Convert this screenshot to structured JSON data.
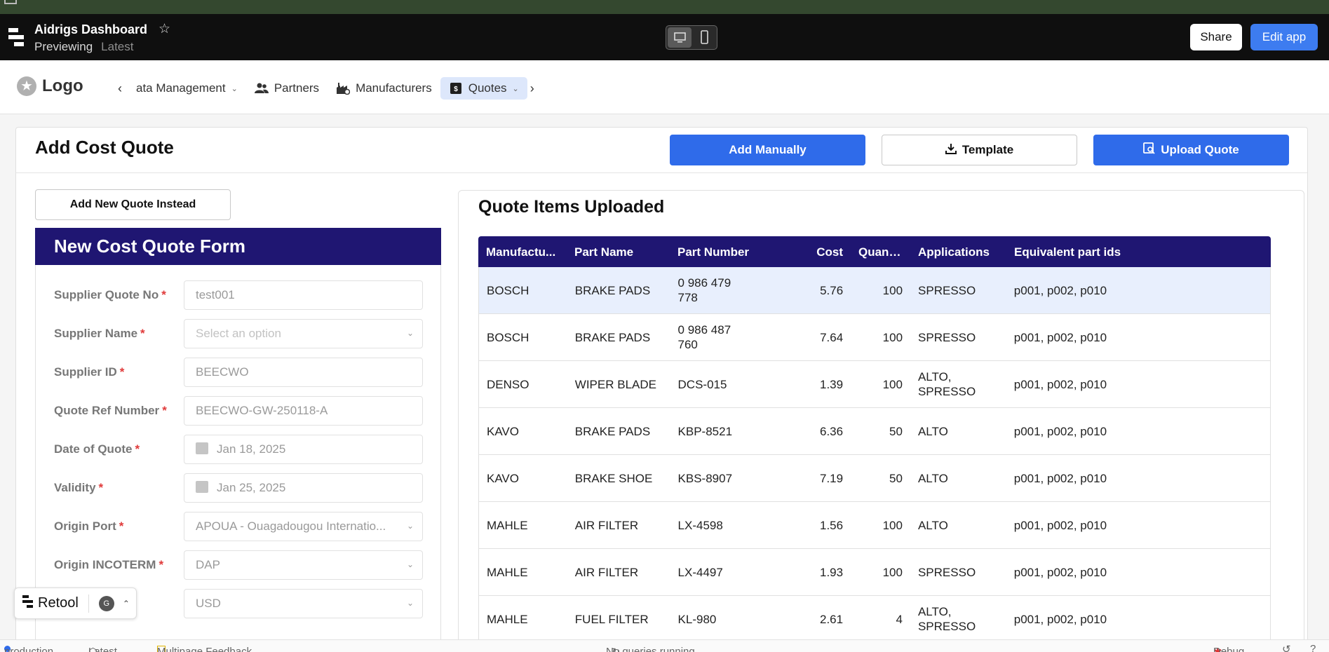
{
  "appbar": {
    "title": "Aidrigs Dashboard",
    "mode": "Previewing",
    "version": "Latest",
    "share_label": "Share",
    "edit_label": "Edit app"
  },
  "nav": {
    "logo_text": "Logo",
    "items": [
      {
        "label": "ata Management",
        "icon": "chevron-down-icon"
      },
      {
        "label": "Partners",
        "icon": "users-icon"
      },
      {
        "label": "Manufacturers",
        "icon": "factory-icon"
      },
      {
        "label": "Quotes",
        "icon": "receipt-icon",
        "active": true
      }
    ]
  },
  "page": {
    "title": "Add Cost Quote",
    "add_manually_label": "Add Manually",
    "template_label": "Template",
    "upload_quote_label": "Upload Quote",
    "add_new_quote_label": "Add New Quote Instead"
  },
  "form": {
    "header": "New Cost Quote Form",
    "fields": [
      {
        "label": "Supplier Quote No",
        "value": "test001",
        "type": "text"
      },
      {
        "label": "Supplier Name",
        "value": "Select an option",
        "type": "select-placeholder"
      },
      {
        "label": "Supplier ID",
        "value": "BEECWO",
        "type": "text"
      },
      {
        "label": "Quote Ref Number",
        "value": "BEECWO-GW-250118-A",
        "type": "text"
      },
      {
        "label": "Date of Quote",
        "value": "Jan 18, 2025",
        "type": "date"
      },
      {
        "label": "Validity",
        "value": "Jan 25, 2025",
        "type": "date"
      },
      {
        "label": "Origin Port",
        "value": "APOUA - Ouagadougou Internatio...",
        "type": "select"
      },
      {
        "label": "Origin INCOTERM",
        "value": "DAP",
        "type": "select"
      },
      {
        "label": "",
        "value": "USD",
        "type": "select"
      }
    ],
    "required_mark": "*"
  },
  "quote_items": {
    "title": "Quote Items Uploaded",
    "columns": [
      "Manufactu...",
      "Part Name",
      "Part Number",
      "Cost",
      "Quant...",
      "Applications",
      "Equivalent part ids"
    ],
    "rows": [
      {
        "manufacturer": "BOSCH",
        "part_name": "BRAKE PADS",
        "part_number": "0 986 479 778",
        "cost": "5.76",
        "quantity": "100",
        "applications": "SPRESSO",
        "equivalent": "p001, p002, p010",
        "selected": true
      },
      {
        "manufacturer": "BOSCH",
        "part_name": "BRAKE PADS",
        "part_number": "0 986 487 760",
        "cost": "7.64",
        "quantity": "100",
        "applications": "SPRESSO",
        "equivalent": "p001, p002, p010"
      },
      {
        "manufacturer": "DENSO",
        "part_name": "WIPER BLADE",
        "part_number": "DCS-015",
        "cost": "1.39",
        "quantity": "100",
        "applications": "ALTO, SPRESSO",
        "equivalent": "p001, p002, p010"
      },
      {
        "manufacturer": "KAVO",
        "part_name": "BRAKE PADS",
        "part_number": "KBP-8521",
        "cost": "6.36",
        "quantity": "50",
        "applications": "ALTO",
        "equivalent": "p001, p002, p010"
      },
      {
        "manufacturer": "KAVO",
        "part_name": "BRAKE SHOE",
        "part_number": "KBS-8907",
        "cost": "7.19",
        "quantity": "50",
        "applications": "ALTO",
        "equivalent": "p001, p002, p010"
      },
      {
        "manufacturer": "MAHLE",
        "part_name": "AIR FILTER",
        "part_number": "LX-4598",
        "cost": "1.56",
        "quantity": "100",
        "applications": "ALTO",
        "equivalent": "p001, p002, p010"
      },
      {
        "manufacturer": "MAHLE",
        "part_name": "AIR FILTER",
        "part_number": "LX-4497",
        "cost": "1.93",
        "quantity": "100",
        "applications": "SPRESSO",
        "equivalent": "p001, p002, p010"
      },
      {
        "manufacturer": "MAHLE",
        "part_name": "FUEL FILTER",
        "part_number": "KL-980",
        "cost": "2.61",
        "quantity": "4",
        "applications": "ALTO, SPRESSO",
        "equivalent": "p001, p002, p010"
      }
    ]
  },
  "retool": {
    "label": "Retool",
    "avatar_letter": "G"
  },
  "statusbar": {
    "env": "production",
    "version": "Latest",
    "feedback": "Multipage Feedback",
    "queries": "No queries running",
    "debug": "Debug"
  },
  "colors": {
    "primary": "#2f6bea",
    "header_navy": "#1f1672",
    "appbar_bg": "#0f0f0f",
    "required": "#e03a3a"
  }
}
